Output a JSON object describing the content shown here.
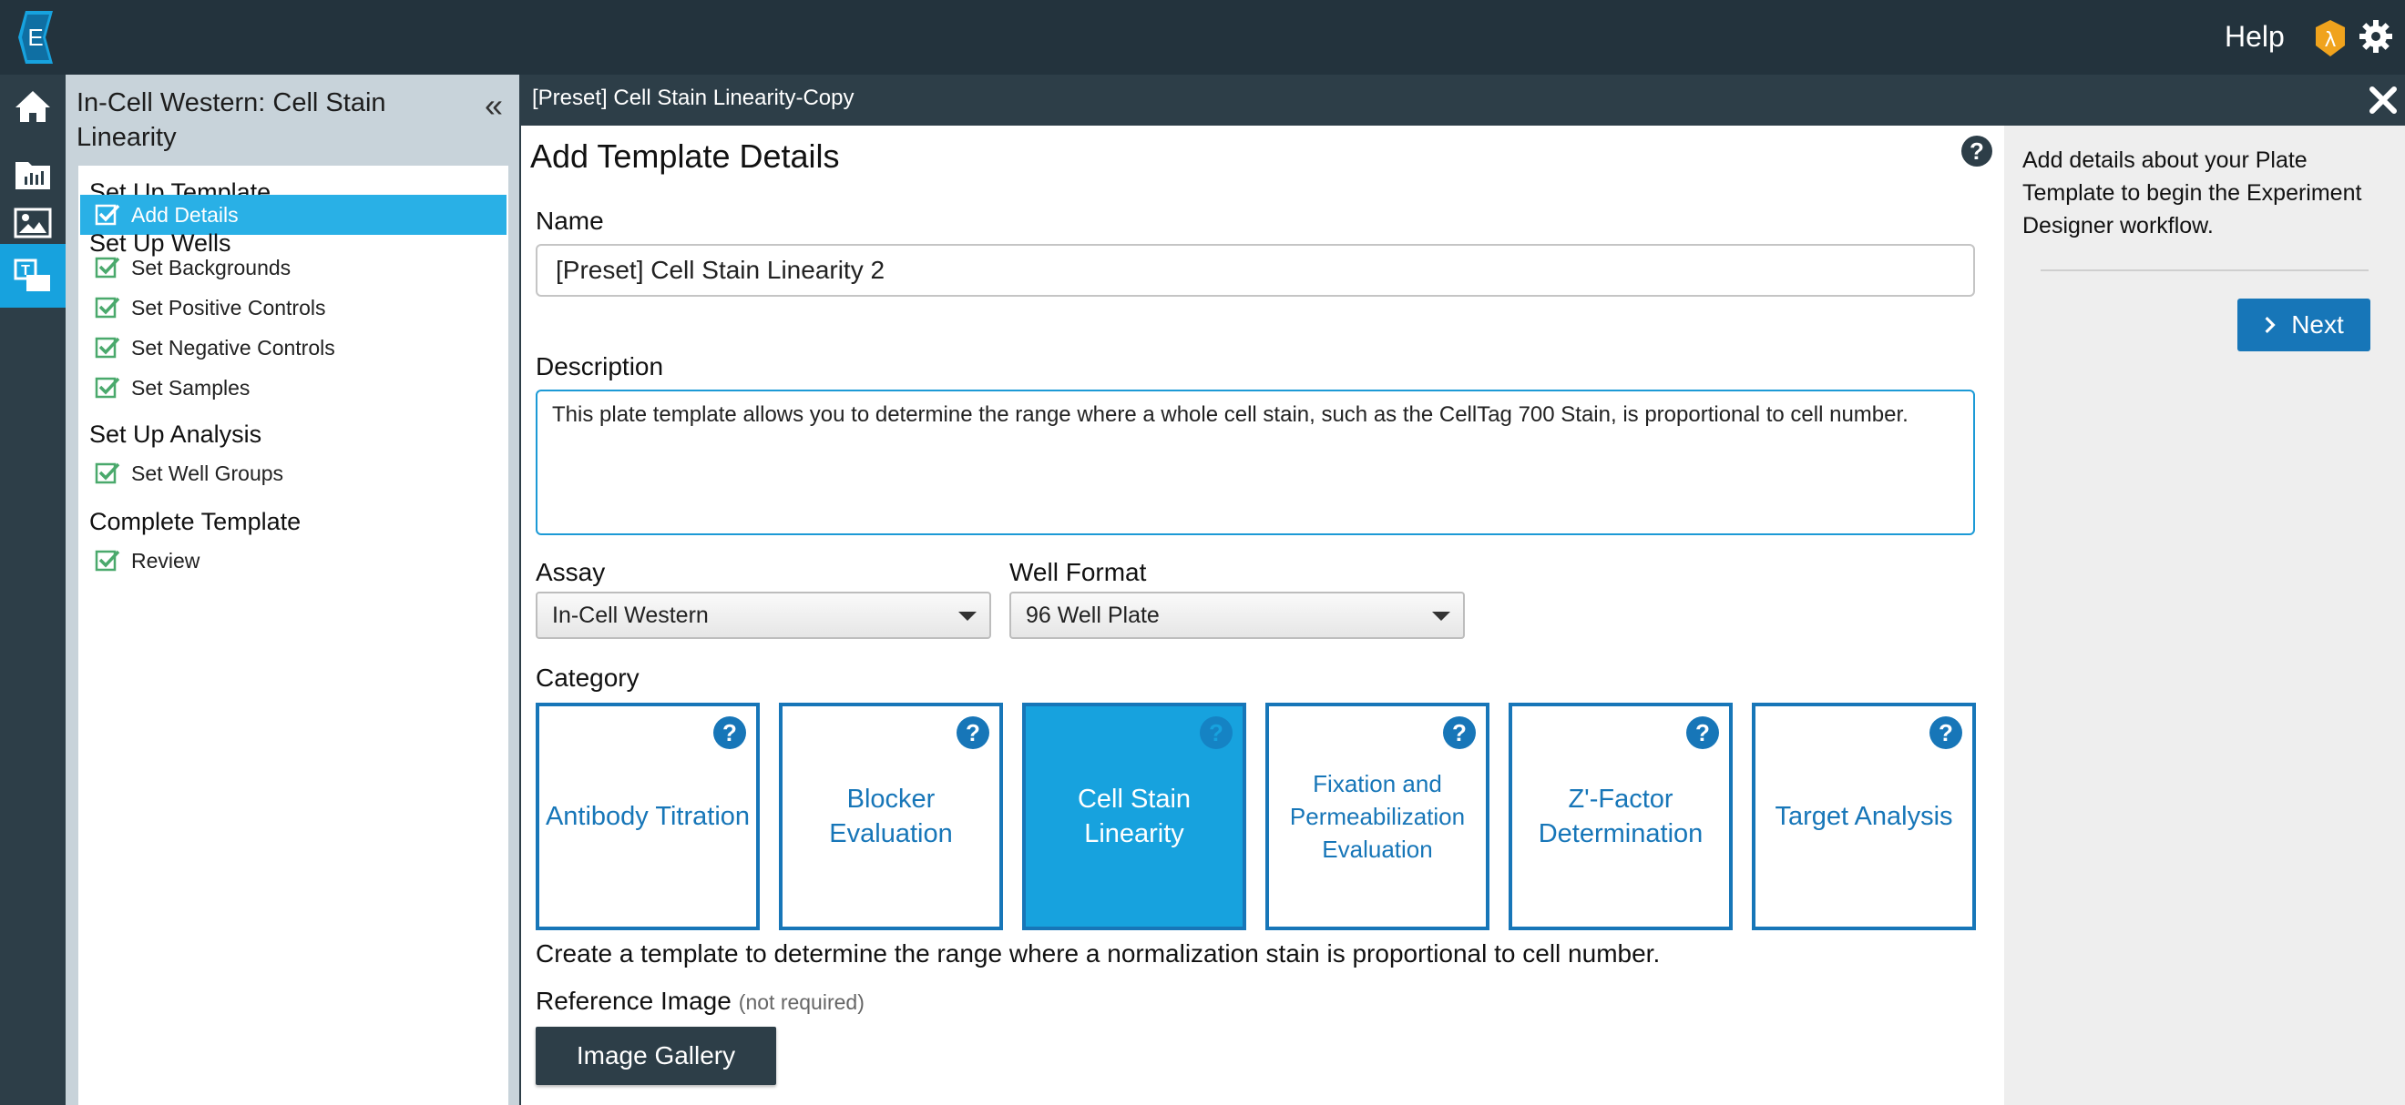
{
  "topbar": {
    "logo_letter": "E",
    "help_label": "Help",
    "user_badge_glyph": "λ",
    "brand_color": "#17a2de",
    "badge_color": "#f0a31d"
  },
  "rail": {
    "items": [
      {
        "icon": "home-icon"
      },
      {
        "icon": "folder-chart-icon"
      },
      {
        "icon": "image-icon"
      },
      {
        "icon": "antibody-icon"
      },
      {
        "icon": "template-icon"
      }
    ]
  },
  "sidebar": {
    "title": "In-Cell Western: Cell Stain Linearity",
    "collapse_glyph": "«",
    "groups": [
      {
        "label": "Set Up Template",
        "items": [
          {
            "label": "Add Details",
            "selected": true
          }
        ]
      },
      {
        "label": "Set Up Wells",
        "items": [
          {
            "label": "Set Backgrounds"
          },
          {
            "label": "Set Positive Controls"
          },
          {
            "label": "Set Negative Controls"
          },
          {
            "label": "Set Samples"
          }
        ]
      },
      {
        "label": "Set Up Analysis",
        "items": [
          {
            "label": "Set Well Groups"
          }
        ]
      },
      {
        "label": "Complete Template",
        "items": [
          {
            "label": "Review"
          }
        ]
      }
    ]
  },
  "header": {
    "breadcrumb": "[Preset] Cell Stain Linearity-Copy"
  },
  "main": {
    "title": "Add Template Details",
    "name_label": "Name",
    "name_value": "[Preset] Cell Stain Linearity 2",
    "description_label": "Description",
    "description_value": "This plate template allows you to determine the range where a whole cell stain, such as the CellTag 700 Stain, is proportional to cell number.",
    "assay_label": "Assay",
    "assay_value": "In-Cell Western",
    "well_format_label": "Well Format",
    "well_format_value": "96 Well Plate",
    "category_label": "Category",
    "categories": [
      {
        "label": "Antibody Titration"
      },
      {
        "label": "Blocker Evaluation"
      },
      {
        "label": "Cell Stain Linearity",
        "selected": true
      },
      {
        "label": "Fixation and Permeabilization Evaluation"
      },
      {
        "label": "Z'-Factor Determination"
      },
      {
        "label": "Target Analysis"
      }
    ],
    "category_description": "Create a template to determine the range where a normalization stain is proportional to cell number.",
    "reference_image_label": "Reference Image",
    "reference_image_note": "(not required)",
    "gallery_button": "Image Gallery"
  },
  "right_panel": {
    "text": "Add details about your Plate Template to begin the Experiment Designer workflow.",
    "next_label": "Next"
  }
}
